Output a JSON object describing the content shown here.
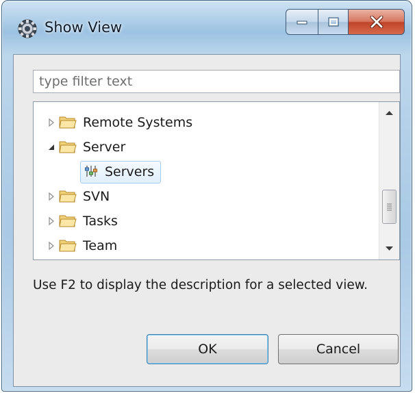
{
  "window": {
    "title": "Show View",
    "app_icon": "eclipse-gear-icon",
    "controls": {
      "minimize": "minimize-icon",
      "maximize": "maximize-icon",
      "close": "close-icon"
    }
  },
  "filter": {
    "placeholder": "type filter text",
    "value": ""
  },
  "tree": {
    "items": [
      {
        "label": "Remote Systems",
        "expanded": false,
        "level": 0,
        "icon": "folder-icon"
      },
      {
        "label": "Server",
        "expanded": true,
        "level": 0,
        "icon": "folder-icon"
      },
      {
        "label": "Servers",
        "level": 1,
        "selected": true,
        "icon": "servers-view-icon"
      },
      {
        "label": "SVN",
        "expanded": false,
        "level": 0,
        "icon": "folder-icon"
      },
      {
        "label": "Tasks",
        "expanded": false,
        "level": 0,
        "icon": "folder-icon"
      },
      {
        "label": "Team",
        "expanded": false,
        "level": 0,
        "icon": "folder-icon"
      }
    ]
  },
  "hint": "Use F2 to display the description for a selected view.",
  "buttons": {
    "ok": "OK",
    "cancel": "Cancel"
  },
  "colors": {
    "selection_border": "#a6cdf0",
    "folder": "#f0c060",
    "close_button": "#c8452c"
  }
}
